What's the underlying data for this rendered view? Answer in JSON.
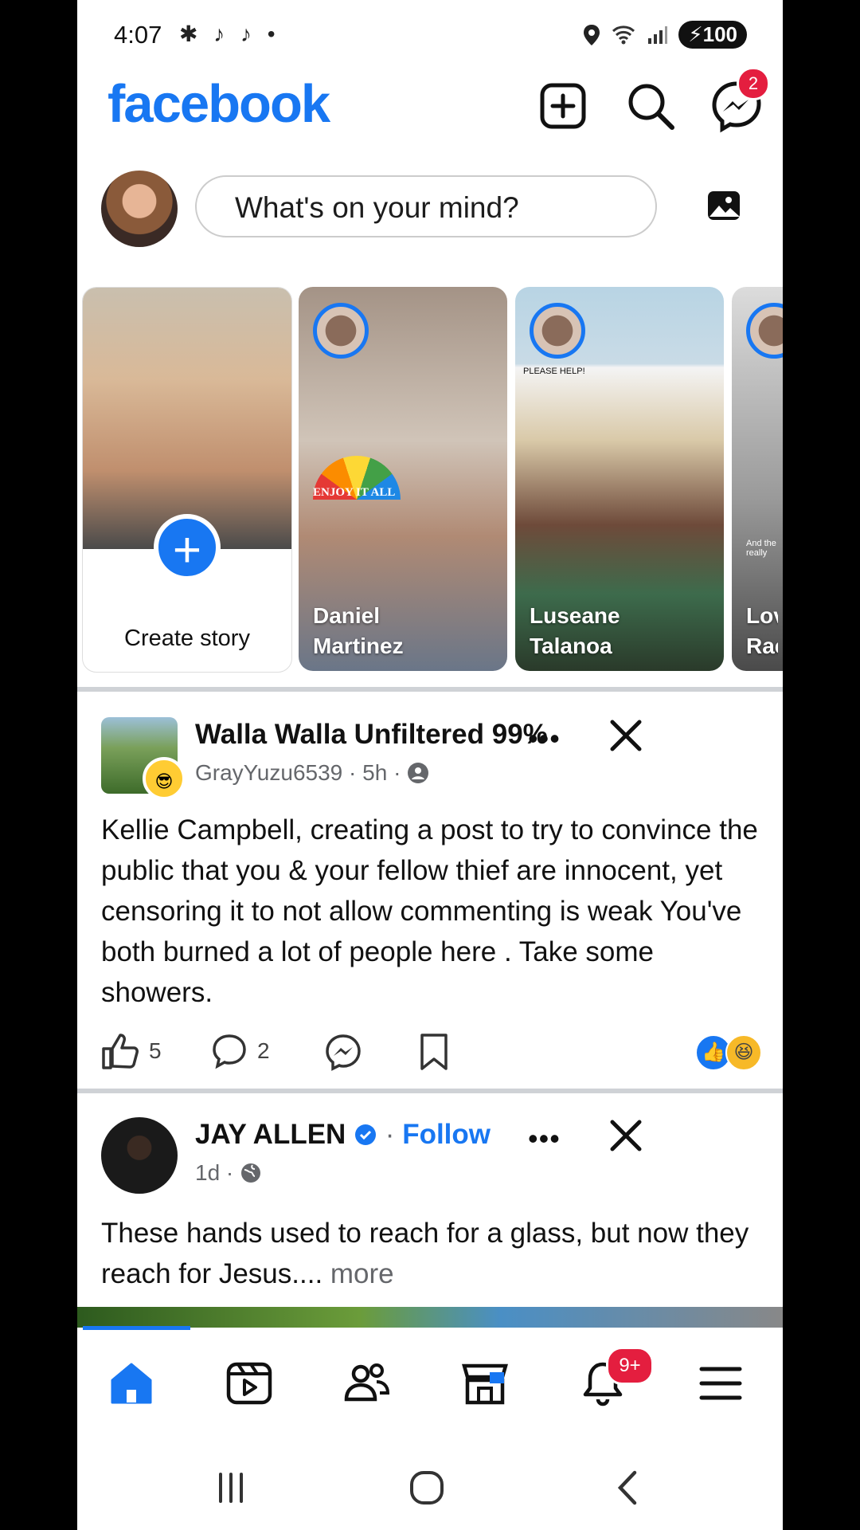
{
  "status_bar": {
    "time": "4:07",
    "notification_icons": "✱ ♪ ♪ •",
    "battery": "100"
  },
  "header": {
    "logo": "facebook",
    "messenger_badge": "2",
    "colors": {
      "brand": "#1877f2",
      "badge": "#e41e3f"
    }
  },
  "composer": {
    "placeholder": "What's on your mind?"
  },
  "stories": {
    "create_label": "Create story",
    "items": [
      {
        "name": "Daniel Martinez",
        "overlay": "ENJOY IT ALL"
      },
      {
        "name": "Luseane Talanoa",
        "overlay": "PLEASE HELP!"
      },
      {
        "name": "Lov Rac",
        "overlay": "And the really"
      }
    ]
  },
  "posts": [
    {
      "title": "Walla Walla Unfiltered 99%",
      "author": "GrayYuzu6539",
      "time": "5h",
      "text": "Kellie Campbell, creating a post to try to convince the public that you & your fellow thief are innocent, yet censoring it to not allow commenting is weak  You've both burned a lot of people here .  Take some showers.",
      "likes": "5",
      "comments": "2"
    },
    {
      "title": "JAY ALLEN",
      "follow": "Follow",
      "time": "1d",
      "text": "These hands used to reach for a glass, but now they reach for Jesus....",
      "more": "more"
    }
  ],
  "bottom_nav": {
    "items": [
      "home-icon",
      "video-icon",
      "friends-icon",
      "marketplace-icon",
      "notifications-icon",
      "menu-icon"
    ],
    "notifications_badge": "9+"
  }
}
